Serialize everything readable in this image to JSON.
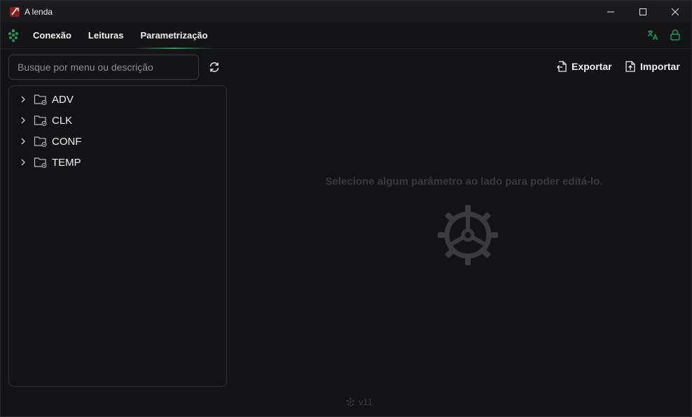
{
  "window": {
    "title": "A lenda"
  },
  "nav": {
    "tabs": [
      {
        "label": "Conexão",
        "active": false
      },
      {
        "label": "Leituras",
        "active": false
      },
      {
        "label": "Parametrização",
        "active": true
      }
    ],
    "accent_color": "#1f9e5a"
  },
  "search": {
    "placeholder": "Busque por menu ou descrição",
    "value": ""
  },
  "tree": {
    "items": [
      {
        "label": "ADV"
      },
      {
        "label": "CLK"
      },
      {
        "label": "CONF"
      },
      {
        "label": "TEMP"
      }
    ]
  },
  "actions": {
    "export_label": "Exportar",
    "import_label": "Importar"
  },
  "editor": {
    "empty_message": "Selecione algum parâmetro ao lado para poder editá-lo."
  },
  "footer": {
    "version": "v11"
  }
}
